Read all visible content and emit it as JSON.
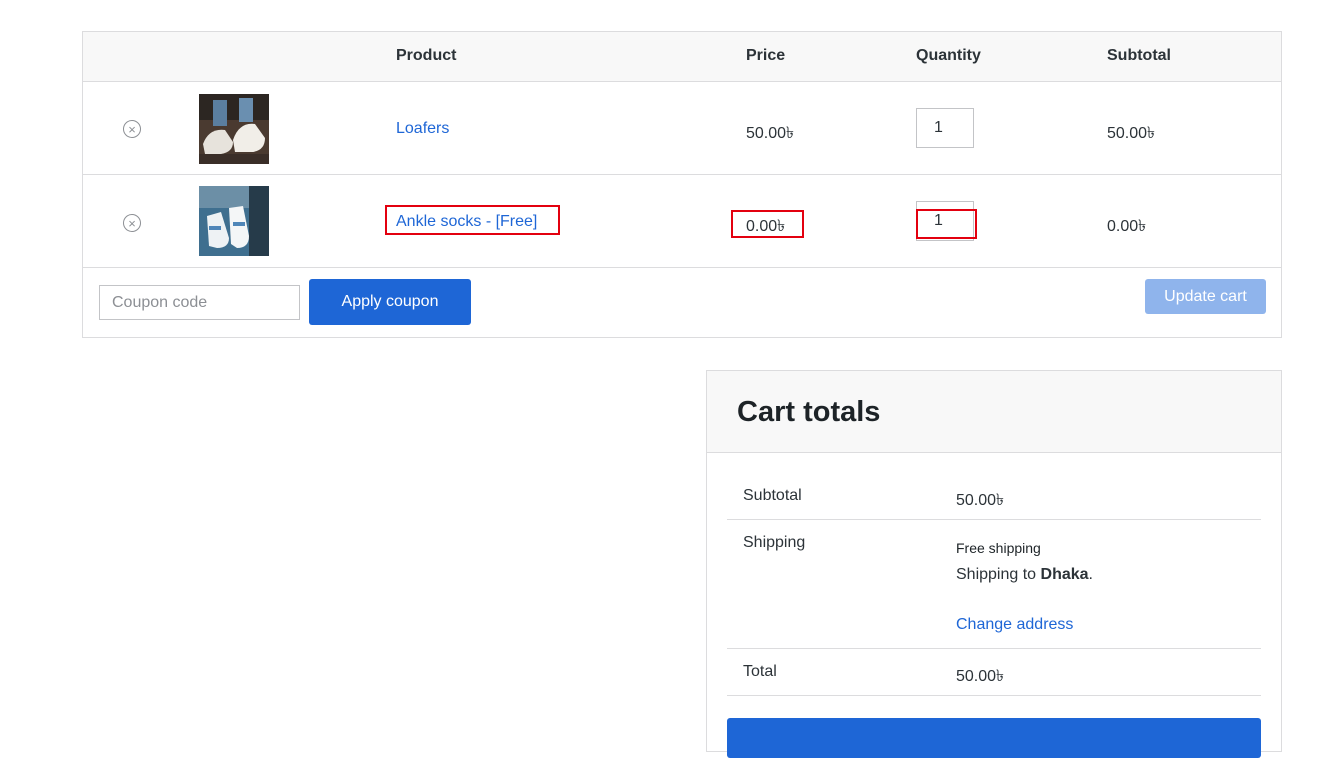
{
  "cart": {
    "headers": {
      "product": "Product",
      "price": "Price",
      "quantity": "Quantity",
      "subtotal": "Subtotal"
    },
    "items": [
      {
        "name": "Loafers",
        "price": "50.00৳",
        "quantity": "1",
        "subtotal": "50.00৳",
        "remove_icon": "close-circle-icon",
        "image": "loafers-product-image"
      },
      {
        "name": "Ankle socks - [Free]",
        "price": "0.00৳",
        "quantity": "1",
        "subtotal": "0.00৳",
        "remove_icon": "close-circle-icon",
        "image": "ankle-socks-product-image"
      }
    ],
    "remove_symbol": "×",
    "coupon_placeholder": "Coupon code",
    "apply_coupon_label": "Apply coupon",
    "update_cart_label": "Update cart"
  },
  "totals": {
    "title": "Cart totals",
    "subtotal_label": "Subtotal",
    "subtotal_value": "50.00৳",
    "shipping_label": "Shipping",
    "shipping_method": "Free shipping",
    "shipping_to_prefix": "Shipping to ",
    "shipping_location": "Dhaka",
    "shipping_to_suffix": ".",
    "change_address_label": "Change address",
    "total_label": "Total",
    "total_value": "50.00৳"
  },
  "colors": {
    "accent": "#1e66d6",
    "accent_disabled": "#8fb4ec",
    "highlight": "#e3000f",
    "border": "#dcdcde",
    "header_bg": "#f8f8f8"
  }
}
